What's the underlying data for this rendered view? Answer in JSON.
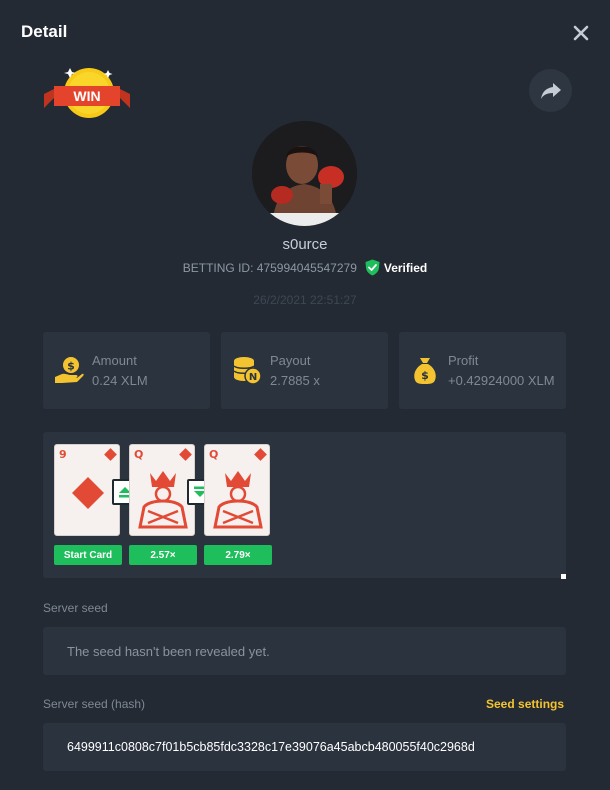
{
  "header": {
    "title": "Detail"
  },
  "badge": {
    "text": "WIN"
  },
  "player": {
    "username": "s0urce",
    "betting_id_label": "BETTING ID:",
    "betting_id": "475994045547279",
    "verified_label": "Verified",
    "timestamp": "26/2/2021 22:51:27"
  },
  "stats": [
    {
      "label": "Amount",
      "value": "0.24 XLM",
      "icon": "money-hand-icon"
    },
    {
      "label": "Payout",
      "value": "2.7885 x",
      "icon": "coin-stack-icon"
    },
    {
      "label": "Profit",
      "value": "+0.42924000 XLM",
      "icon": "money-bag-icon"
    }
  ],
  "cards": [
    {
      "rank": "9",
      "suit": "diamonds",
      "multiplier": "Start Card"
    },
    {
      "rank": "Q",
      "suit": "diamonds",
      "multiplier": "2.57×",
      "guess": "higher"
    },
    {
      "rank": "Q",
      "suit": "diamonds",
      "multiplier": "2.79×",
      "guess": "lower"
    }
  ],
  "server_seed": {
    "label": "Server seed",
    "value": "The seed hasn't been revealed yet."
  },
  "server_seed_hash": {
    "label": "Server seed (hash)",
    "settings_label": "Seed settings",
    "value": "6499911c0808c7f01b5cb85fdc3328c17e39076a45abcb480055f40c2968d"
  },
  "colors": {
    "background": "#232a33",
    "card_panel": "#2b333e",
    "accent_green": "#1fbe5c",
    "accent_yellow": "#f4c430",
    "suit_red": "#e24a36"
  }
}
